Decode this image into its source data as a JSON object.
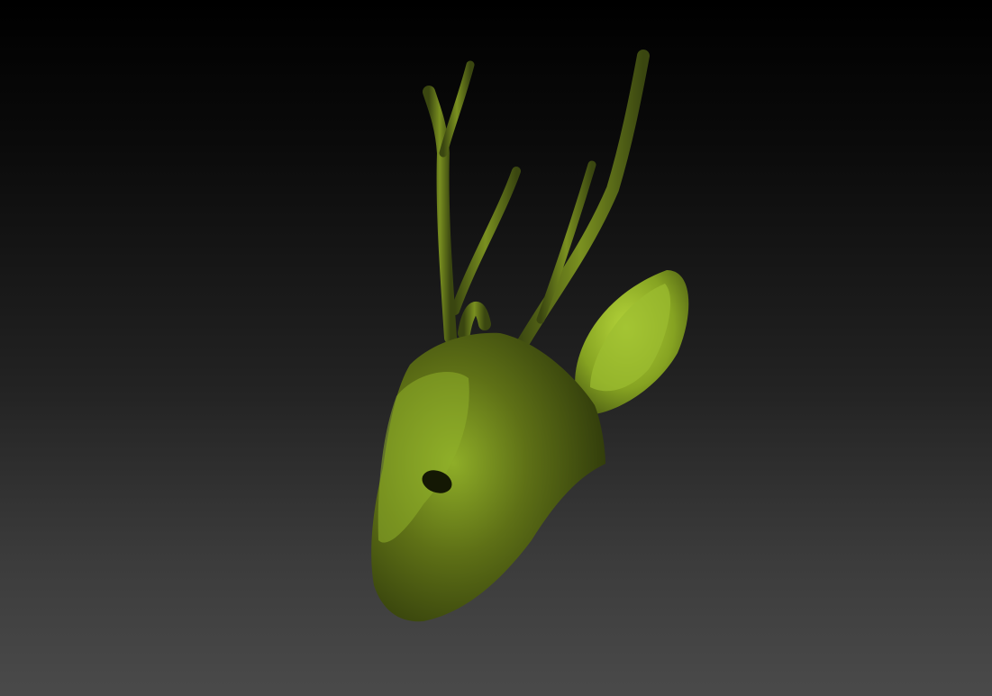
{
  "scene": {
    "subject": "deer-head-mesh",
    "colors": {
      "background_top": "#000000",
      "background_bottom": "#4a4a4a",
      "mesh_dark": "#3e4a10",
      "mesh_mid": "#6a7d1c",
      "mesh_light": "#a8c732"
    }
  }
}
